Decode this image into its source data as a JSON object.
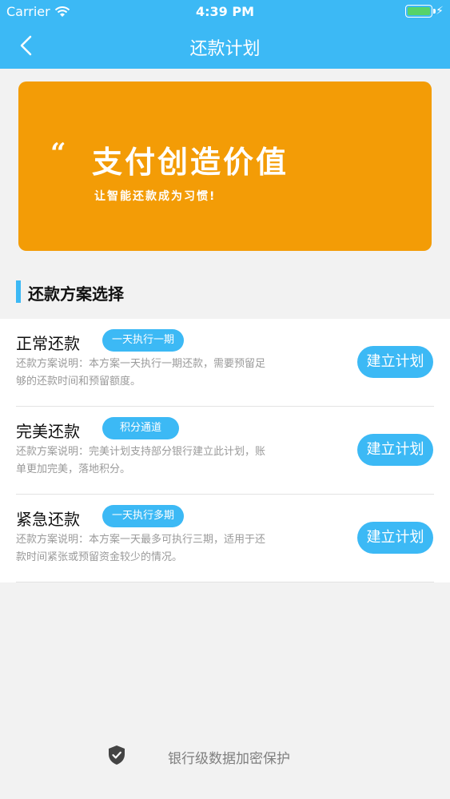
{
  "status_bar": {
    "carrier": "Carrier",
    "time": "4:39 PM"
  },
  "nav": {
    "title": "还款计划",
    "back_icon": "chevron-left-icon"
  },
  "banner": {
    "quote": "“",
    "slogan": "支付创造价值",
    "subtitle": "让智能还款成为习惯!"
  },
  "section": {
    "title": "还款方案选择"
  },
  "plans": [
    {
      "name": "正常还款",
      "tag": "一天执行一期",
      "desc_line1": "还款方案说明：本方案一天执行一期还款，需要预留足",
      "desc_line2": "够的还款时间和预留额度。",
      "button": "建立计划"
    },
    {
      "name": "完美还款",
      "tag": "积分通道",
      "desc_line1": "还款方案说明：完美计划支持部分银行建立此计划，账",
      "desc_line2": "单更加完美，落地积分。",
      "button": "建立计划"
    },
    {
      "name": "紧急还款",
      "tag": "一天执行多期",
      "desc_line1": "还款方案说明：本方案一天最多可执行三期，适用于还",
      "desc_line2": "款时间紧张或预留资金较少的情况。",
      "button": "建立计划"
    }
  ],
  "footer": {
    "text": "银行级数据加密保护",
    "icon": "shield-check-icon"
  },
  "colors": {
    "primary": "#3cb9f5",
    "banner": "#f39c06",
    "battery": "#56d36a"
  }
}
